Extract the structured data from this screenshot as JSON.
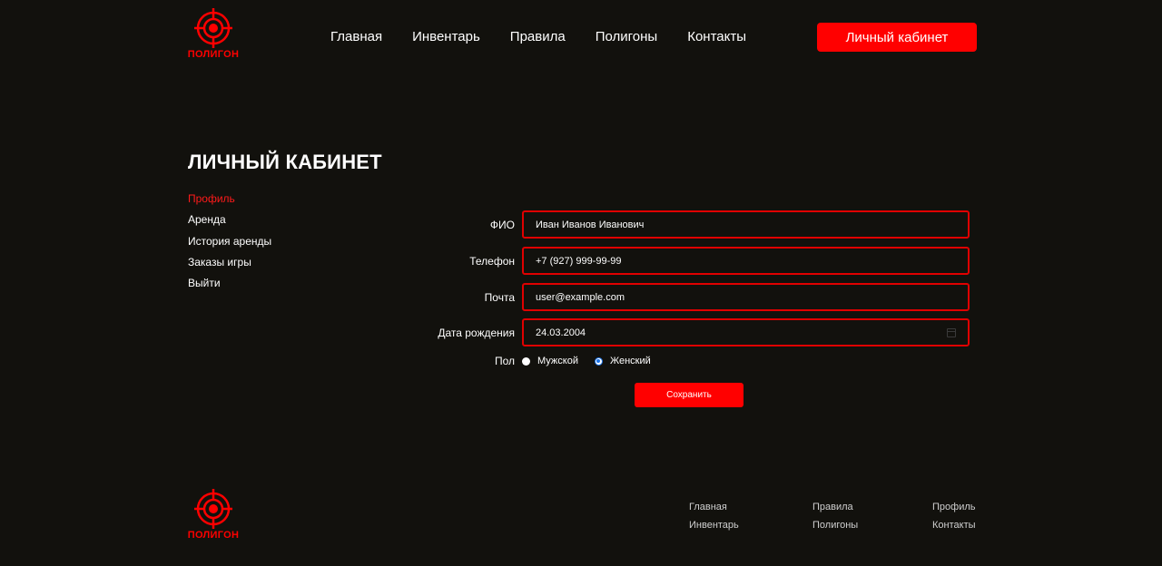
{
  "brand": {
    "name": "ПОЛИГОН",
    "accent_color": "#ff0000",
    "logo_icon": "target-crosshair-icon"
  },
  "nav": {
    "items": [
      "Главная",
      "Инвентарь",
      "Правила",
      "Полигоны",
      "Контакты"
    ],
    "cabinet_button": "Личный кабинет"
  },
  "page_title": "ЛИЧНЫЙ КАБИНЕТ",
  "side_menu": {
    "items": [
      "Профиль",
      "Аренда",
      "История аренды",
      "Заказы игры",
      "Выйти"
    ],
    "active": "Профиль"
  },
  "form": {
    "fio": {
      "label": "ФИО",
      "value": "Иван Иванов Иванович"
    },
    "phone": {
      "label": "Телефон",
      "value": "+7 (927) 999-99-99"
    },
    "email": {
      "label": "Почта",
      "value": "user@example.com"
    },
    "birthdate": {
      "label": "Дата рождения",
      "value": "24.03.2004",
      "icon": "calendar-icon"
    },
    "gender": {
      "label": "Пол",
      "options": [
        "Мужской",
        "Женский"
      ],
      "selected": "Женский"
    },
    "save_button": "Сохранить"
  },
  "footer": {
    "columns": [
      [
        "Главная",
        "Инвентарь"
      ],
      [
        "Правила",
        "Полигоны"
      ],
      [
        "Профиль",
        "Контакты"
      ]
    ]
  }
}
